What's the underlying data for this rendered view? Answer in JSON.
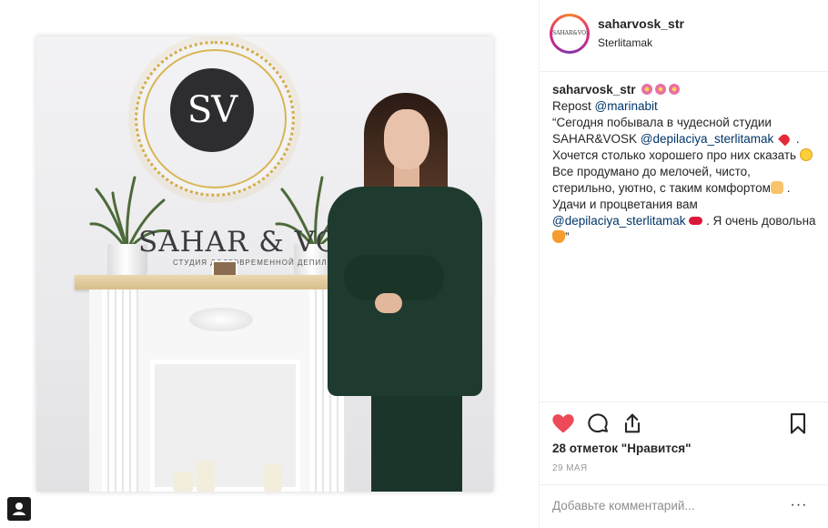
{
  "post": {
    "username": "saharvosk_str",
    "location": "Sterlitamak",
    "avatar_text": "SAHAR&VOSK",
    "photo": {
      "logo_text": "SV",
      "brand_text": "SAHAR & VOSK",
      "brand_subtext": "СТУДИЯ ДОЛГОВРЕМЕННОЙ ДЕПИЛЯЦИИ"
    },
    "caption": {
      "username": "saharvosk_str",
      "repost_label": "Repost",
      "repost_mention": "@marinabit",
      "text_1": "“Сегодня побывала в чудесной студии SAHAR&VOSK ",
      "mention_1": "@depilaciya_sterlitamak",
      "text_2": " . Хочется столько хорошего про них сказать ",
      "text_3": " Все продумано до мелочей, чисто, стерильно, уютно, с таким комфортом",
      "text_4": " . Удачи и процветания вам ",
      "mention_2": "@depilaciya_sterlitamak",
      "text_5": " . Я очень довольна ",
      "text_6": "”"
    },
    "likes_text": "28 отметок \"Нравится\"",
    "date_text": "29 МАЯ",
    "comment_placeholder": "Добавьте комментарий...",
    "more_label": "···",
    "colors": {
      "like_red": "#ed4956",
      "text": "#262626",
      "muted": "#999999",
      "mention": "#003569"
    }
  }
}
